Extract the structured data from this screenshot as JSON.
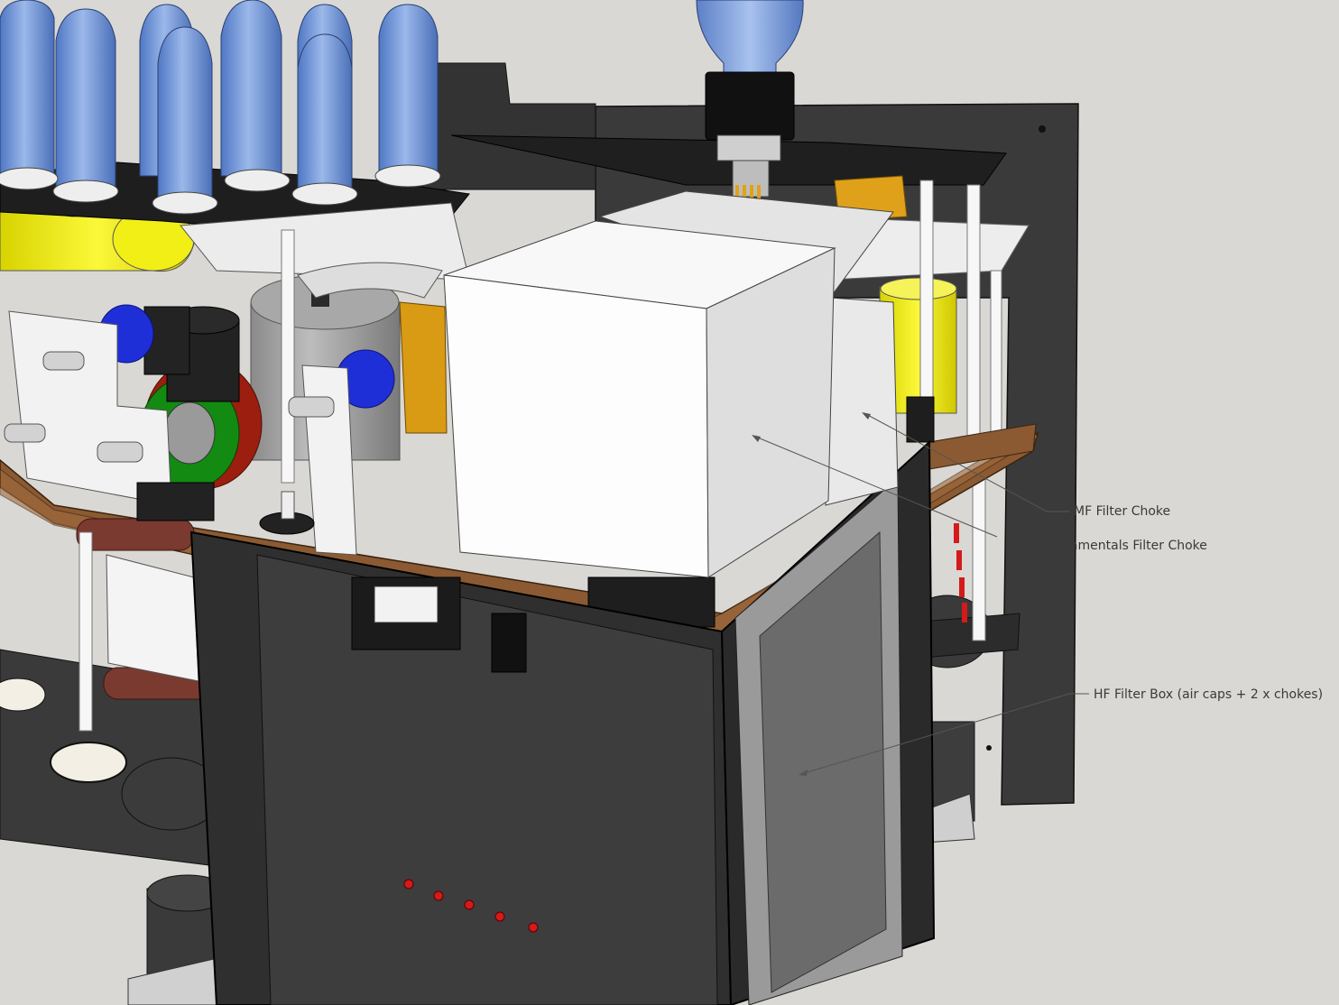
{
  "labels": {
    "mf_filter_choke": "MF Filter Choke",
    "fundamentals_filter_choke": "Fundamentals Filter Choke",
    "hf_filter_box": "HF Filter Box (air caps + 2 x chokes)"
  },
  "colors": {
    "background": "#d9d8d4",
    "chassis": "#2e2e2e",
    "tube_glass": "#6f95d6",
    "pcb": "#8b5a32",
    "choke_white": "#f4f4f4",
    "capacitor_yellow": "#f2ef17",
    "capacitor_blue": "#1f2fd8",
    "leader_line": "#555555"
  }
}
